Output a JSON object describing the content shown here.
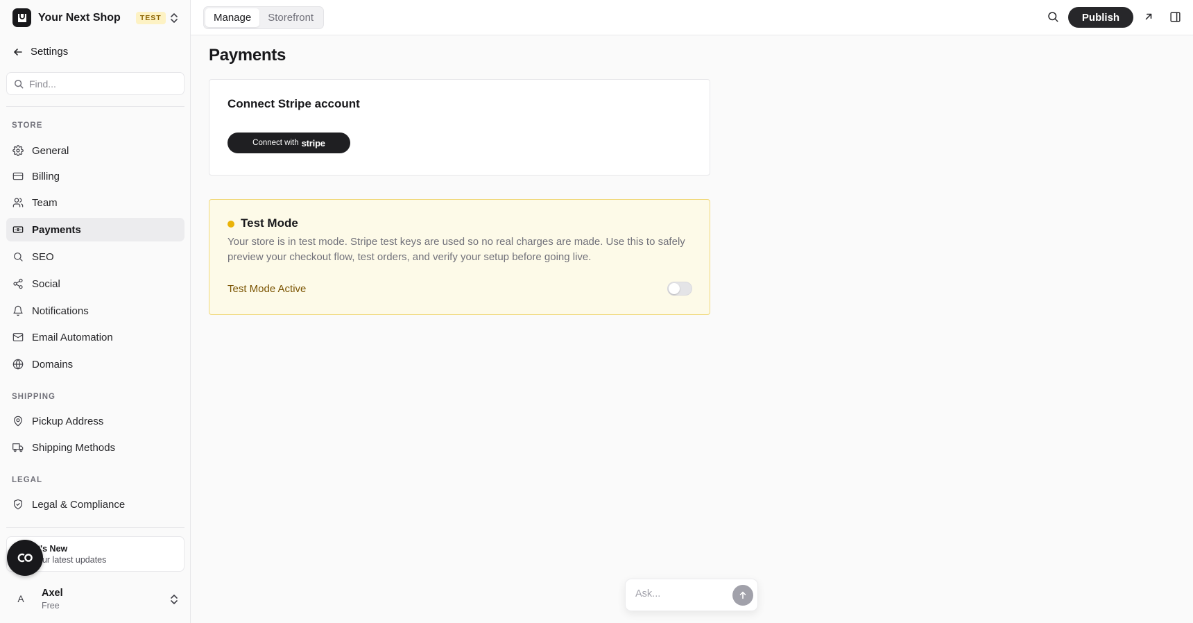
{
  "brand": {
    "name": "Your Next Shop",
    "badge": "TEST"
  },
  "sidebar": {
    "back_label": "Settings",
    "search_placeholder": "Find...",
    "sections": {
      "store": "STORE",
      "shipping": "SHIPPING",
      "legal": "LEGAL"
    },
    "items": [
      {
        "label": "General",
        "icon": "gear-icon"
      },
      {
        "label": "Billing",
        "icon": "credit-card-icon"
      },
      {
        "label": "Team",
        "icon": "users-icon"
      },
      {
        "label": "Payments",
        "icon": "banknote-icon",
        "active": true
      },
      {
        "label": "SEO",
        "icon": "search-icon"
      },
      {
        "label": "Social",
        "icon": "share-icon"
      },
      {
        "label": "Notifications",
        "icon": "bell-icon"
      },
      {
        "label": "Email Automation",
        "icon": "mail-icon"
      },
      {
        "label": "Domains",
        "icon": "globe-icon"
      },
      {
        "label": "Pickup Address",
        "icon": "map-pin-icon"
      },
      {
        "label": "Shipping Methods",
        "icon": "truck-icon"
      },
      {
        "label": "Legal & Compliance",
        "icon": "shield-check-icon"
      }
    ],
    "whats_new": {
      "title": "t's New",
      "subtitle": "our latest updates"
    },
    "user": {
      "initial": "A",
      "name": "Axel",
      "plan": "Free"
    }
  },
  "topbar": {
    "tabs": [
      {
        "label": "Manage",
        "active": true
      },
      {
        "label": "Storefront",
        "active": false
      }
    ],
    "publish_label": "Publish"
  },
  "main": {
    "title": "Payments",
    "stripe_card": {
      "title": "Connect Stripe account",
      "button_prefix": "Connect with",
      "button_brand": "stripe"
    },
    "test_mode": {
      "title": "Test Mode",
      "description": "Your store is in test mode. Stripe test keys are used so no real charges are made. Use this to safely preview your checkout flow, test orders, and verify your setup before going live.",
      "toggle_label": "Test Mode Active",
      "enabled": false
    }
  },
  "ask": {
    "placeholder": "Ask..."
  },
  "colors": {
    "accent": "#27272a",
    "test_badge_bg": "#fdf2c4",
    "test_card_bg": "#fdfae8",
    "test_card_border": "#f0d879",
    "test_dot": "#eab308"
  }
}
